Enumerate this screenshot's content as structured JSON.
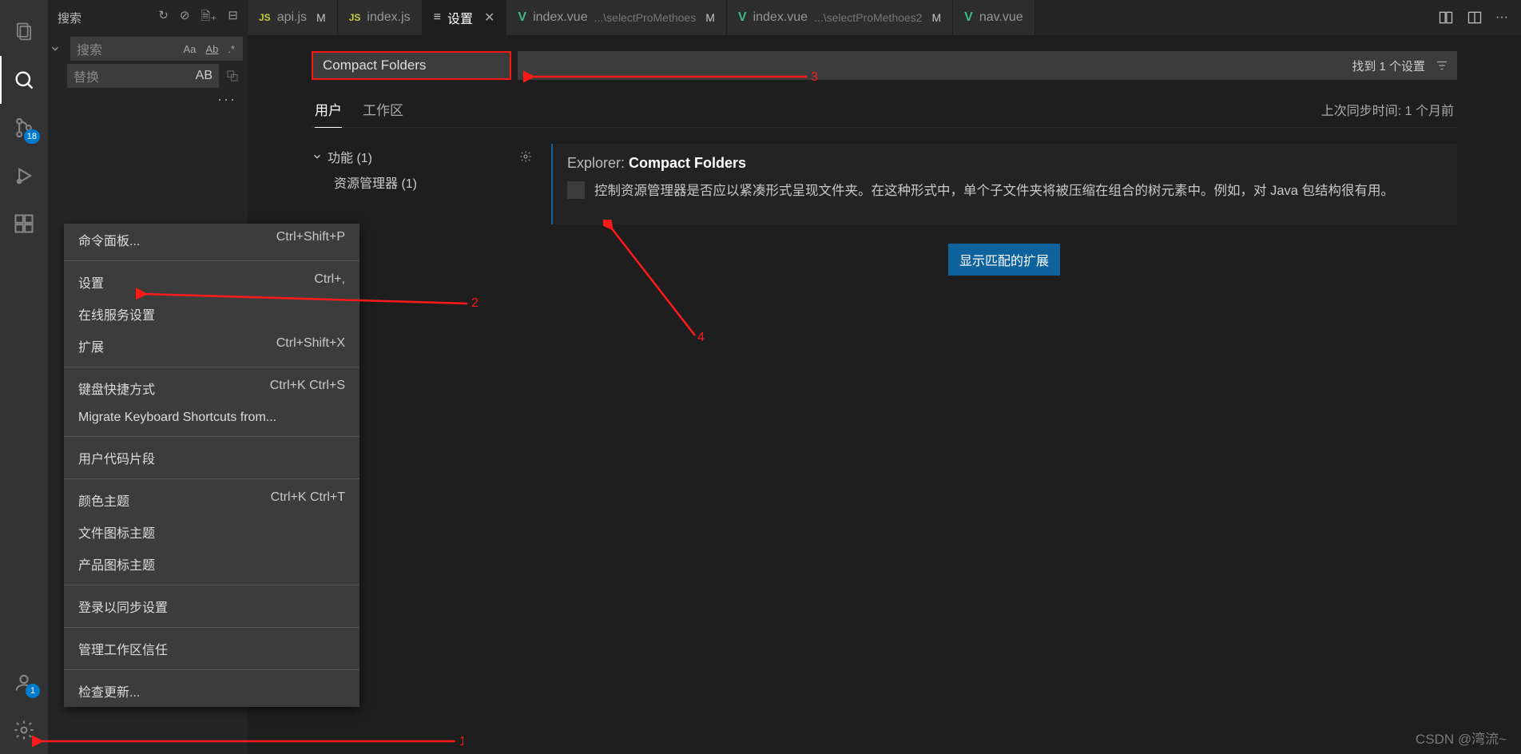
{
  "activitybar": {
    "scm_badge": "18",
    "account_badge": "1"
  },
  "sidebar": {
    "title": "搜索",
    "search_placeholder": "搜索",
    "replace_placeholder": "替换",
    "opt_case": "Aa",
    "opt_word": "Ab",
    "opt_regex": ".*",
    "opt_preserve": "AB"
  },
  "tabs": [
    {
      "icon": "js",
      "label": "api.js",
      "mod": "M"
    },
    {
      "icon": "js",
      "label": "index.js",
      "mod": ""
    },
    {
      "icon": "settings",
      "label": "设置",
      "mod": "",
      "active": true,
      "close": true
    },
    {
      "icon": "vue",
      "label": "index.vue",
      "sub": "...\\selectProMethoes",
      "mod": "M"
    },
    {
      "icon": "vue",
      "label": "index.vue",
      "sub": "...\\selectProMethoes2",
      "mod": "M"
    },
    {
      "icon": "vue",
      "label": "nav.vue",
      "mod": ""
    }
  ],
  "settings": {
    "search_value": "Compact Folders",
    "result_count": "找到 1 个设置",
    "tab_user": "用户",
    "tab_workspace": "工作区",
    "sync_info": "上次同步时间: 1 个月前",
    "tree_parent": "功能 (1)",
    "tree_child": "资源管理器 (1)",
    "item_prefix": "Explorer: ",
    "item_name": "Compact Folders",
    "item_desc": "控制资源管理器是否应以紧凑形式呈现文件夹。在这种形式中，单个子文件夹将被压缩在组合的树元素中。例如，对 Java 包结构很有用。",
    "show_ext_btn": "显示匹配的扩展"
  },
  "menu": {
    "items": [
      {
        "label": "命令面板...",
        "shortcut": "Ctrl+Shift+P"
      },
      {
        "sep": true
      },
      {
        "label": "设置",
        "shortcut": "Ctrl+,"
      },
      {
        "label": "在线服务设置",
        "shortcut": ""
      },
      {
        "label": "扩展",
        "shortcut": "Ctrl+Shift+X"
      },
      {
        "sep": true
      },
      {
        "label": "键盘快捷方式",
        "shortcut": "Ctrl+K Ctrl+S"
      },
      {
        "label": "Migrate Keyboard Shortcuts from...",
        "shortcut": ""
      },
      {
        "sep": true
      },
      {
        "label": "用户代码片段",
        "shortcut": ""
      },
      {
        "sep": true
      },
      {
        "label": "颜色主题",
        "shortcut": "Ctrl+K Ctrl+T"
      },
      {
        "label": "文件图标主题",
        "shortcut": ""
      },
      {
        "label": "产品图标主题",
        "shortcut": ""
      },
      {
        "sep": true
      },
      {
        "label": "登录以同步设置",
        "shortcut": ""
      },
      {
        "sep": true
      },
      {
        "label": "管理工作区信任",
        "shortcut": ""
      },
      {
        "sep": true
      },
      {
        "label": "检查更新...",
        "shortcut": ""
      }
    ]
  },
  "annotations": {
    "n1": "1",
    "n2": "2",
    "n3": "3",
    "n4": "4"
  },
  "watermark": "CSDN @湾流~"
}
